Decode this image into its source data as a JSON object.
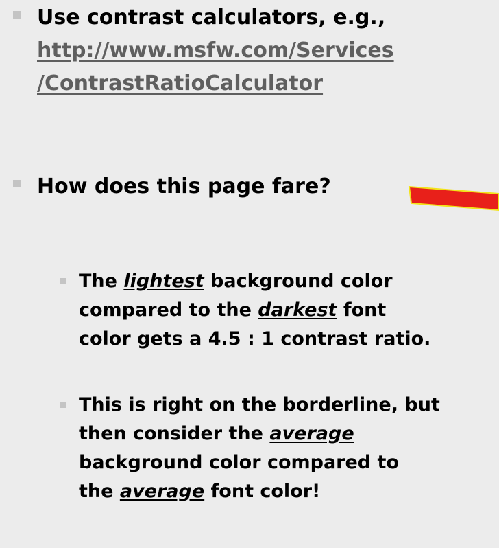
{
  "bullets": {
    "b1": {
      "text": "Use contrast calculators, e.g.,",
      "link_line1": "http://www.msfw.com/Services",
      "link_line2": "/ContrastRatioCalculator"
    },
    "b2": {
      "text": "How does this page fare?"
    },
    "sub1": {
      "pre": "The ",
      "emph1": "lightest",
      "mid1": " background color",
      "line2_pre": "compared to the ",
      "emph2": "darkest",
      "line2_post": " font",
      "line3": "color gets a 4.5 : 1 contrast ratio."
    },
    "sub2": {
      "line1": "This is right on the borderline, but",
      "line2_pre": "then consider the ",
      "emph1": "average",
      "line3": "background color compared to",
      "line4_pre": "the ",
      "emph2": "average",
      "line4_post": " font color!"
    }
  },
  "colors": {
    "background": "#ececec",
    "bullet": "#c4c4c4",
    "link": "#5f5f5f",
    "arrow_fill": "#e8201a",
    "arrow_outline": "#f2e31b"
  }
}
